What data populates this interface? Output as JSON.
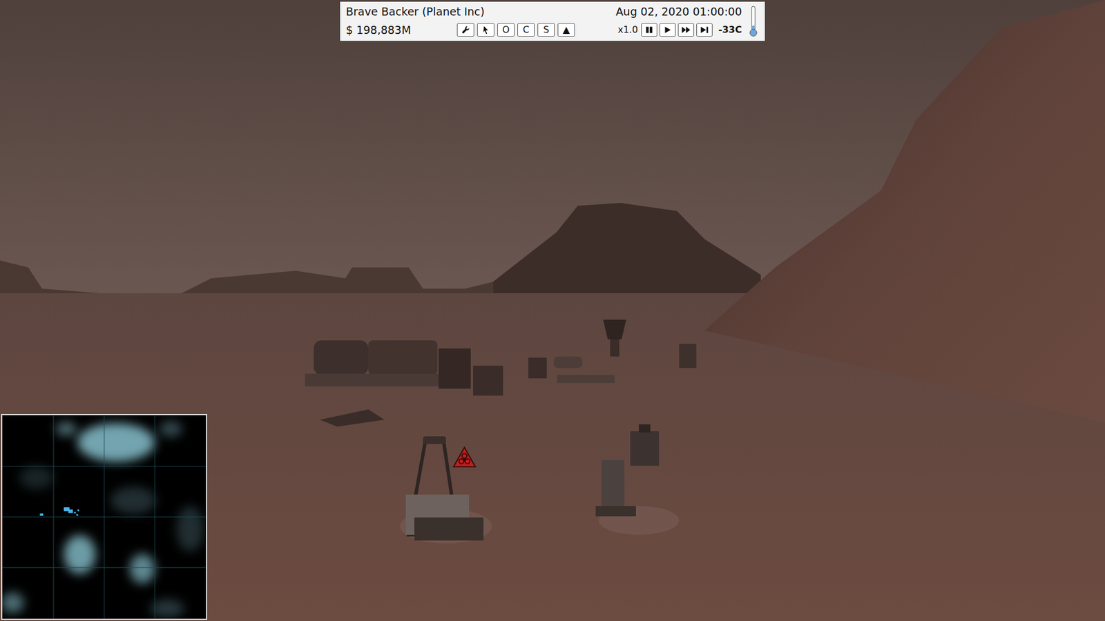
{
  "hud": {
    "company": "Brave Backer (Planet Inc)",
    "money": "$ 198,883M",
    "date": "Aug 02, 2020 01:00:00",
    "speed": "x1.0",
    "temperature": "-33C",
    "thermometer_level": 0.12,
    "tools": [
      {
        "kind": "wrench"
      },
      {
        "kind": "cursor"
      },
      {
        "kind": "text",
        "label": "O"
      },
      {
        "kind": "text",
        "label": "C"
      },
      {
        "kind": "text",
        "label": "S"
      },
      {
        "kind": "text",
        "label": "▲"
      }
    ],
    "time_controls": [
      {
        "kind": "pause"
      },
      {
        "kind": "play"
      },
      {
        "kind": "fast-forward"
      },
      {
        "kind": "skip"
      }
    ]
  },
  "scene": {
    "alerts": [
      {
        "kind": "biohazard"
      }
    ]
  }
}
